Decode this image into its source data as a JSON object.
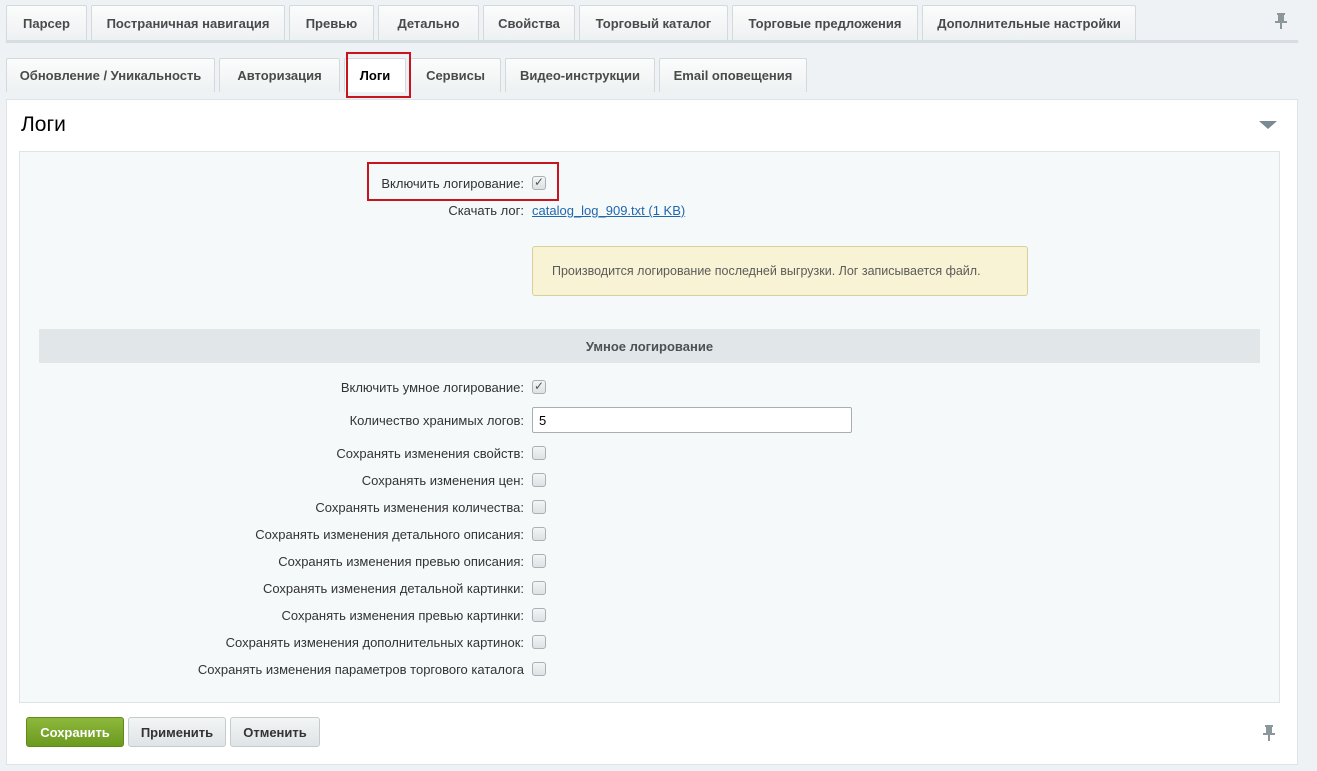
{
  "tabs_top": [
    {
      "label": "Парсер"
    },
    {
      "label": "Постраничная навигация"
    },
    {
      "label": "Превью"
    },
    {
      "label": "Детально"
    },
    {
      "label": "Свойства"
    },
    {
      "label": "Торговый каталог"
    },
    {
      "label": "Торговые предложения"
    },
    {
      "label": "Дополнительные настройки"
    }
  ],
  "tabs_second": [
    {
      "label": "Обновление / Уникальность"
    },
    {
      "label": "Авторизация"
    },
    {
      "label": "Логи",
      "active": true
    },
    {
      "label": "Сервисы"
    },
    {
      "label": "Видео-инструкции"
    },
    {
      "label": "Email оповещения"
    }
  ],
  "panel": {
    "title": "Логи",
    "enable_logging": {
      "label": "Включить логирование:",
      "checked": true
    },
    "download_log": {
      "label": "Скачать лог:",
      "link": "catalog_log_909.txt (1 KB)"
    },
    "notice": "Производится логирование последней выгрузки. Лог записывается файл.",
    "smart_section_title": "Умное логирование",
    "enable_smart": {
      "label": "Включить умное логирование:",
      "checked": true
    },
    "log_count": {
      "label": "Количество хранимых логов:",
      "value": "5"
    },
    "options": [
      {
        "label": "Сохранять изменения свойств:",
        "checked": false
      },
      {
        "label": "Сохранять изменения цен:",
        "checked": false
      },
      {
        "label": "Сохранять изменения количества:",
        "checked": false
      },
      {
        "label": "Сохранять изменения детального описания:",
        "checked": false
      },
      {
        "label": "Сохранять изменения превью описания:",
        "checked": false
      },
      {
        "label": "Сохранять изменения детальной картинки:",
        "checked": false
      },
      {
        "label": "Сохранять изменения превью картинки:",
        "checked": false
      },
      {
        "label": "Сохранять изменения дополнительных картинок:",
        "checked": false
      },
      {
        "label": "Сохранять изменения параметров торгового каталога",
        "checked": false
      }
    ]
  },
  "buttons": {
    "save": "Сохранить",
    "apply": "Применить",
    "cancel": "Отменить"
  },
  "icons": {
    "pin": "pin-icon",
    "collapse": "triangle-down-icon"
  },
  "colors": {
    "save_button": "#7aa92b",
    "highlight": "#c8141e",
    "link": "#2067b0",
    "notice_bg": "#f8f3d4"
  }
}
